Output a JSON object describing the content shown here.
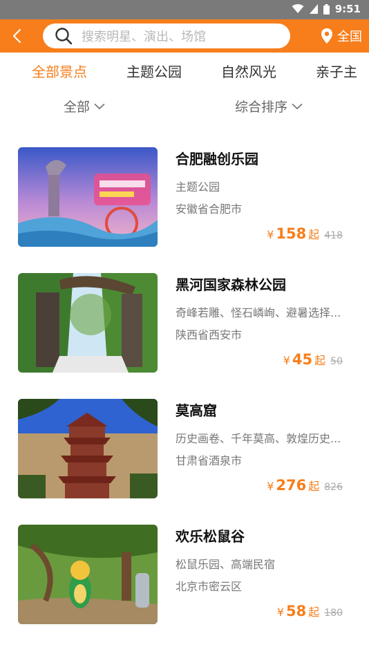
{
  "status_bar": {
    "time": "9:51"
  },
  "header": {
    "search_placeholder": "搜索明星、演出、场馆",
    "location_label": "全国"
  },
  "tabs": [
    {
      "label": "全部景点",
      "active": true
    },
    {
      "label": "主题公园",
      "active": false
    },
    {
      "label": "自然风光",
      "active": false
    },
    {
      "label": "亲子主",
      "active": false
    }
  ],
  "filters": {
    "category": "全部",
    "sort": "综合排序"
  },
  "items": [
    {
      "name": "合肥融创乐园",
      "tags": "主题公园",
      "area": "安徽省合肥市",
      "currency": "¥",
      "price": "158",
      "suffix": "起",
      "original_price": "418"
    },
    {
      "name": "黑河国家森林公园",
      "tags": "奇峰若雕、怪石嶙峋、避暑选择...",
      "area": "陕西省西安市",
      "currency": "¥",
      "price": "45",
      "suffix": "起",
      "original_price": "50"
    },
    {
      "name": "莫高窟",
      "tags": "历史画卷、千年莫高、敦煌历史...",
      "area": "甘肃省酒泉市",
      "currency": "¥",
      "price": "276",
      "suffix": "起",
      "original_price": "826"
    },
    {
      "name": "欢乐松鼠谷",
      "tags": "松鼠乐园、高端民宿",
      "area": "北京市密云区",
      "currency": "¥",
      "price": "58",
      "suffix": "起",
      "original_price": "180"
    }
  ],
  "colors": {
    "accent": "#f77e1b",
    "status_bar": "#7a7a7a"
  }
}
